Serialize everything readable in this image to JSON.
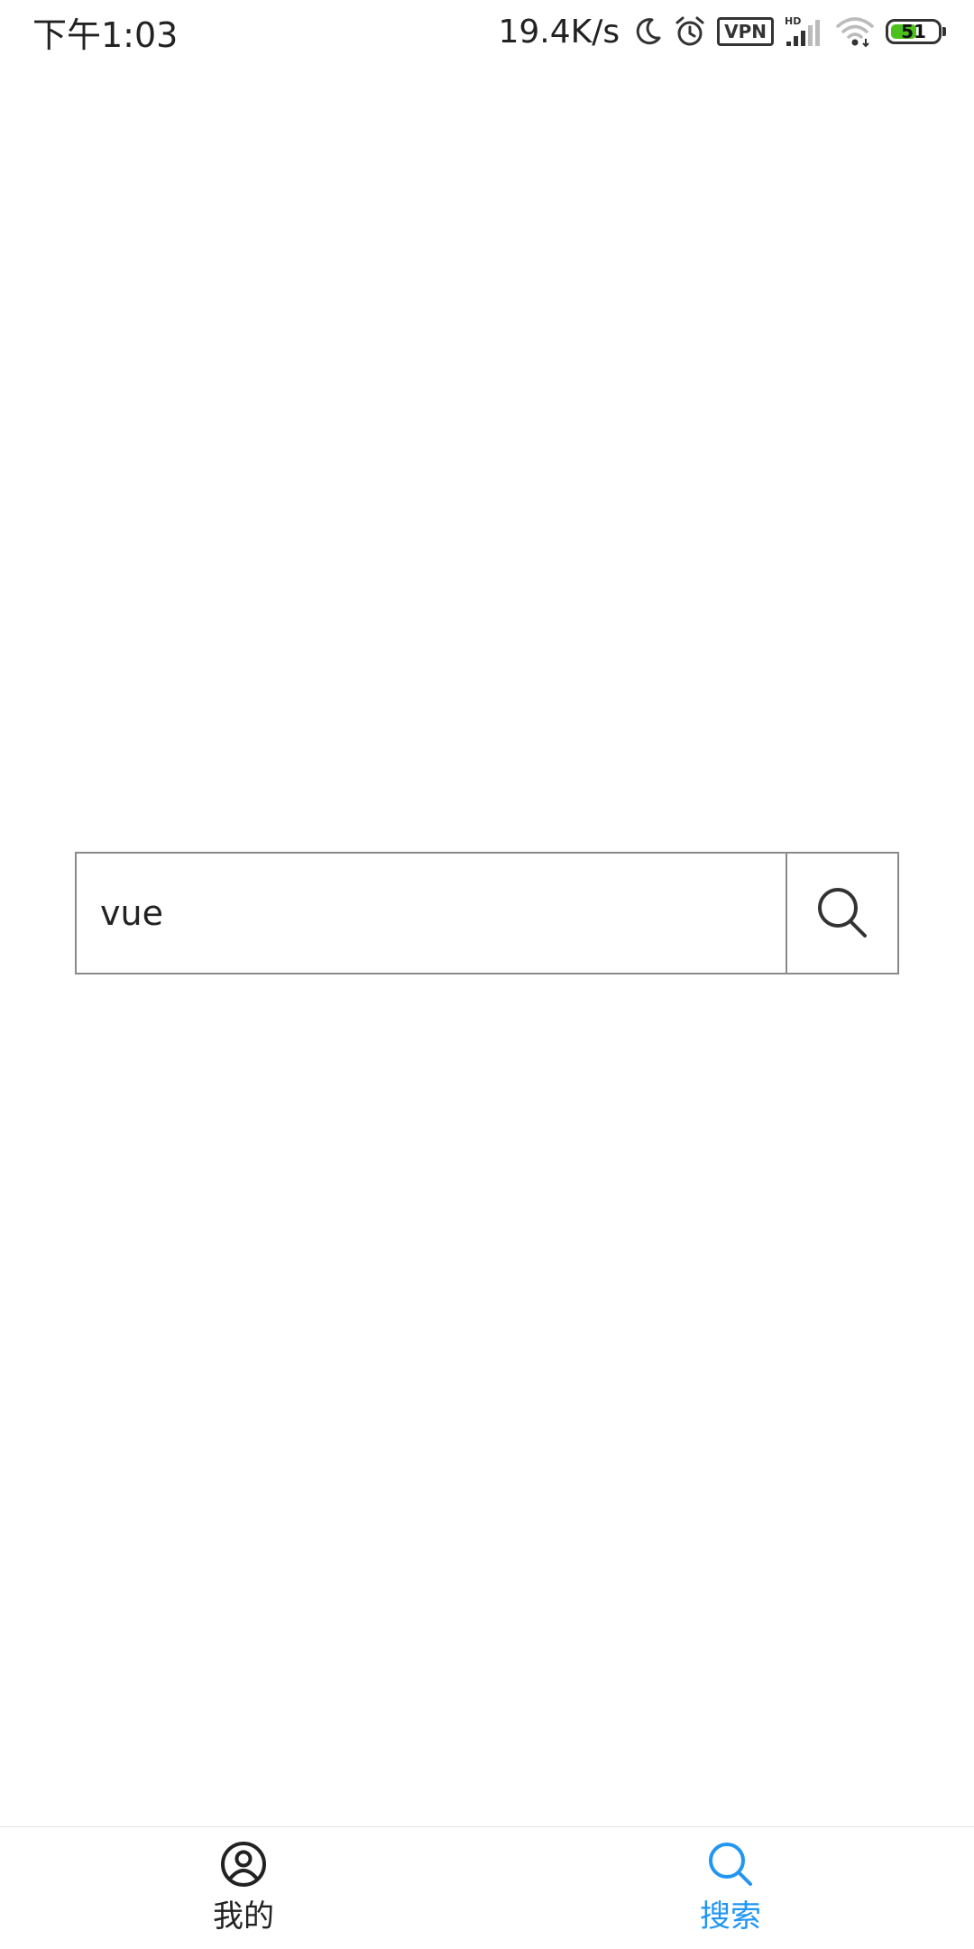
{
  "status_bar": {
    "time": "下午1:03",
    "net_speed": "19.4K/s",
    "vpn_label": "VPN",
    "signal_label": "HD",
    "battery_level": "51",
    "icons": [
      "moon-icon",
      "alarm-icon",
      "vpn-icon",
      "signal-icon",
      "wifi-icon",
      "battery-icon"
    ]
  },
  "search": {
    "value": "vue",
    "button_icon": "search-icon"
  },
  "tab_bar": {
    "tabs": [
      {
        "label": "我的",
        "icon": "user-circle-icon",
        "active": false
      },
      {
        "label": "搜索",
        "icon": "search-icon",
        "active": true
      }
    ],
    "active_color": "#2196f3",
    "inactive_color": "#222222"
  }
}
